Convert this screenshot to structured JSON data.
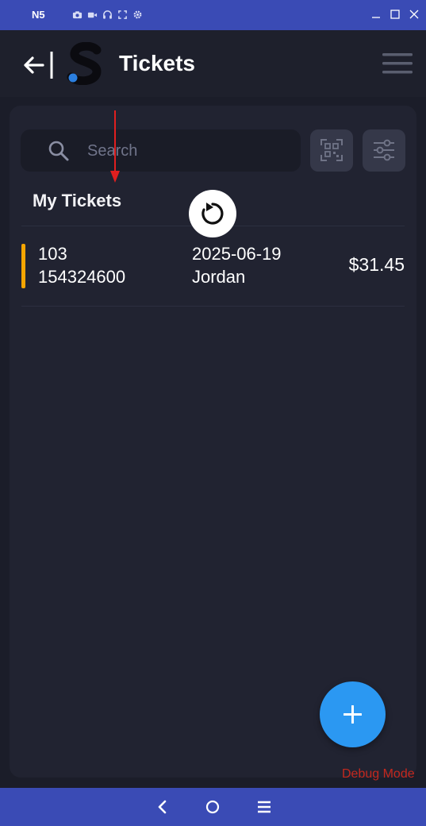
{
  "window": {
    "device_name": "N5",
    "status_icons": [
      "camera-icon",
      "video-icon",
      "headphones-icon",
      "fullscreen-icon",
      "settings-icon"
    ],
    "controls": [
      "minimize-icon",
      "maximize-icon",
      "close-icon"
    ]
  },
  "header": {
    "title": "Tickets",
    "back_icon": "arrow-left-icon",
    "logo_icon": "app-logo-s",
    "menu_icon": "hamburger-menu-icon"
  },
  "search": {
    "placeholder": "Search",
    "value": ""
  },
  "toolbar": {
    "scan_icon": "qr-scan-icon",
    "filter_icon": "sliders-filter-icon"
  },
  "section": {
    "title": "My Tickets"
  },
  "tickets": [
    {
      "number": "103",
      "id": "154324600",
      "date": "2025-06-19",
      "name": "Jordan",
      "amount": "$31.45",
      "status_color": "#f5a500"
    }
  ],
  "debug_label": "Debug Mode",
  "colors": {
    "window_bar": "#3a4bb5",
    "background": "#1b1d29",
    "panel": "#212331",
    "accent": "#2b98f2",
    "annotation_arrow": "#e01f1f",
    "debug_text": "#c4281e"
  },
  "nav": [
    "back-icon",
    "home-icon",
    "recents-icon"
  ]
}
